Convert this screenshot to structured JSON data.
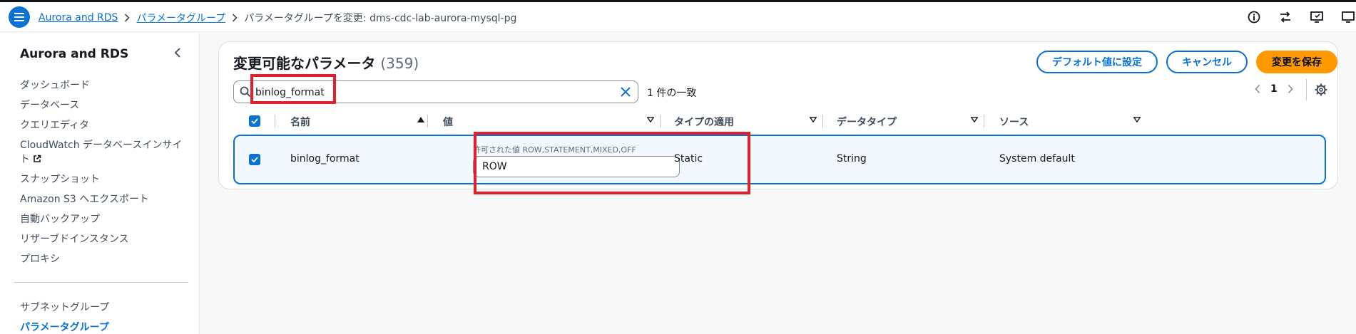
{
  "breadcrumb": {
    "items": [
      "Aurora and RDS",
      "パラメータグループ"
    ],
    "current": "パラメータグループを変更: dms-cdc-lab-aurora-mysql-pg"
  },
  "sidebar": {
    "title": "Aurora and RDS",
    "items": [
      "ダッシュボード",
      "データベース",
      "クエリエディタ",
      "CloudWatch データベースインサイ",
      "ト",
      "スナップショット",
      "Amazon S3 へエクスポート",
      "自動バックアップ",
      "リザーブドインスタンス",
      "プロキシ"
    ],
    "items2": [
      "サブネットグループ",
      "パラメータグループ"
    ]
  },
  "panel": {
    "title": "変更可能なパラメータ",
    "count": "(359)"
  },
  "buttons": {
    "reset_default": "デフォルト値に設定",
    "cancel": "キャンセル",
    "save": "変更を保存"
  },
  "search": {
    "value": "binlog_format",
    "match_count": "1 件の一致"
  },
  "pagination": {
    "current_page": "1"
  },
  "table": {
    "columns": [
      "名前",
      "値",
      "タイプの適用",
      "データタイプ",
      "ソース"
    ],
    "rows": [
      {
        "name": "binlog_format",
        "allowed_values": "許可された値 ROW,STATEMENT,MIXED,OFF",
        "value": "ROW",
        "apply_type": "Static",
        "data_type": "String",
        "source": "System default"
      }
    ]
  },
  "colors": {
    "accent": "#0972d3",
    "primary_button": "#ff9900",
    "annotation": "#e0202c"
  }
}
